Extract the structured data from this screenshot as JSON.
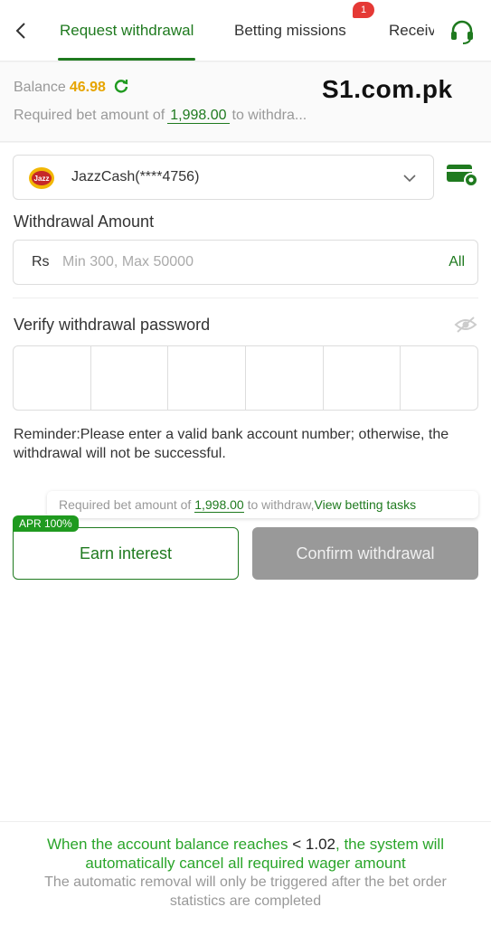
{
  "header": {
    "tabs": [
      {
        "label": "Request withdrawal",
        "active": true
      },
      {
        "label": "Betting missions",
        "badge": "1"
      },
      {
        "label": "Receiv"
      }
    ]
  },
  "watermark": "S1.com.pk",
  "balance": {
    "label": "Balance",
    "value": "46.98",
    "required_prefix": "Required bet amount of",
    "required_amount": "1,998.00",
    "required_suffix": "to withdra..."
  },
  "method": {
    "label": "JazzCash(****4756)",
    "icon_text": "Jazz"
  },
  "amount": {
    "label": "Withdrawal Amount",
    "currency": "Rs",
    "placeholder": "Min 300, Max 50000",
    "all_label": "All"
  },
  "password": {
    "label": "Verify withdrawal password"
  },
  "reminder": "Reminder:Please enter a valid bank account number; otherwise, the withdrawal will not be successful.",
  "tip": {
    "prefix": "Required bet amount of",
    "amount": "1,998.00",
    "suffix": "to withdraw,",
    "link": "View betting tasks"
  },
  "buttons": {
    "apr": "APR 100%",
    "earn": "Earn interest",
    "confirm": "Confirm withdrawal"
  },
  "notice": {
    "part1": "When the account balance reaches",
    "threshold": "< 1.02",
    "part2": ", the system will automatically cancel all required wager amount",
    "line2": "The automatic removal will only be triggered after the bet order statistics are completed"
  },
  "colors": {
    "accent": "#1f7a1f",
    "balance": "#e6a400",
    "badge": "#e53935",
    "disabled_button": "#999999"
  }
}
